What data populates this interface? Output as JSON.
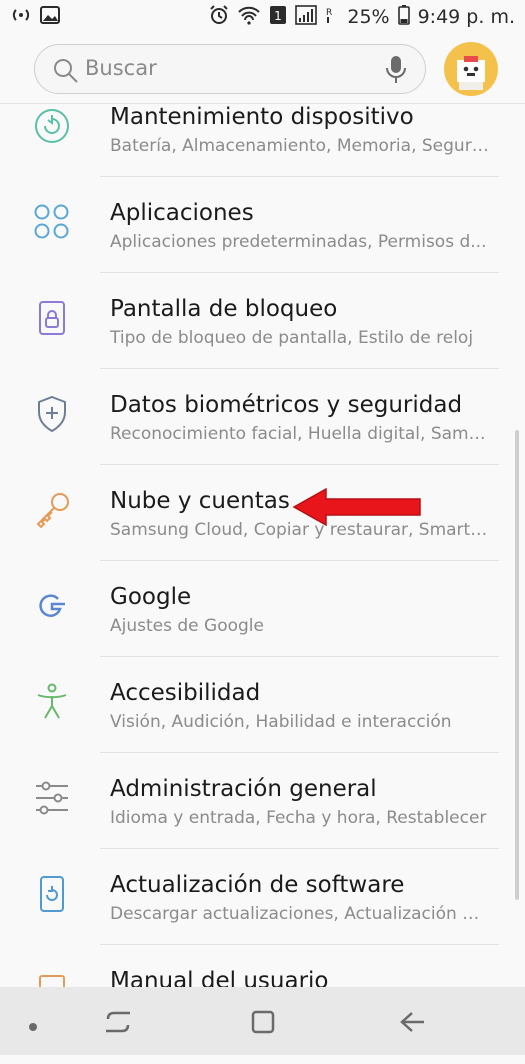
{
  "status_bar": {
    "battery": "25%",
    "time": "9:49 p. m.",
    "icons": [
      "hotspot-icon",
      "image-notification-icon",
      "alarm-icon",
      "wifi-icon",
      "sim1-icon",
      "signal-icon",
      "roaming-icon",
      "battery-icon"
    ]
  },
  "search": {
    "placeholder": "Buscar"
  },
  "settings": [
    {
      "title": "Mantenimiento dispositivo",
      "subtitle": "Batería, Almacenamiento, Memoria, Seguri...",
      "icon": "device-maintenance-icon",
      "color": "#5bbfa7"
    },
    {
      "title": "Aplicaciones",
      "subtitle": "Aplicaciones predeterminadas, Permisos d...",
      "icon": "apps-icon",
      "color": "#5aa7d6"
    },
    {
      "title": "Pantalla de bloqueo",
      "subtitle": "Tipo de bloqueo de pantalla, Estilo de reloj",
      "icon": "lock-screen-icon",
      "color": "#8d79d6"
    },
    {
      "title": "Datos biométricos y seguridad",
      "subtitle": "Reconocimiento facial, Huella digital, Sams...",
      "icon": "shield-icon",
      "color": "#6f7f96"
    },
    {
      "title": "Nube y cuentas",
      "subtitle": "Samsung Cloud, Copiar y restaurar, Smart S...",
      "icon": "key-icon",
      "color": "#e59a57"
    },
    {
      "title": "Google",
      "subtitle": "Ajustes de Google",
      "icon": "google-icon",
      "color": "#5b86d1"
    },
    {
      "title": "Accesibilidad",
      "subtitle": "Visión, Audición, Habilidad e interacción",
      "icon": "accessibility-icon",
      "color": "#64b96a"
    },
    {
      "title": "Administración general",
      "subtitle": "Idioma y entrada, Fecha y hora, Restablecer",
      "icon": "sliders-icon",
      "color": "#8a8a8a"
    },
    {
      "title": "Actualización de software",
      "subtitle": "Descargar actualizaciones, Actualización pr...",
      "icon": "software-update-icon",
      "color": "#4f9ad3"
    },
    {
      "title": "Manual del usuario",
      "subtitle": "",
      "icon": "user-manual-icon",
      "color": "#e59a57"
    }
  ],
  "annotation": {
    "arrow_color": "#e8151b"
  },
  "nav": {
    "icons": [
      "dot-icon",
      "recents-icon",
      "home-icon",
      "back-icon"
    ]
  }
}
